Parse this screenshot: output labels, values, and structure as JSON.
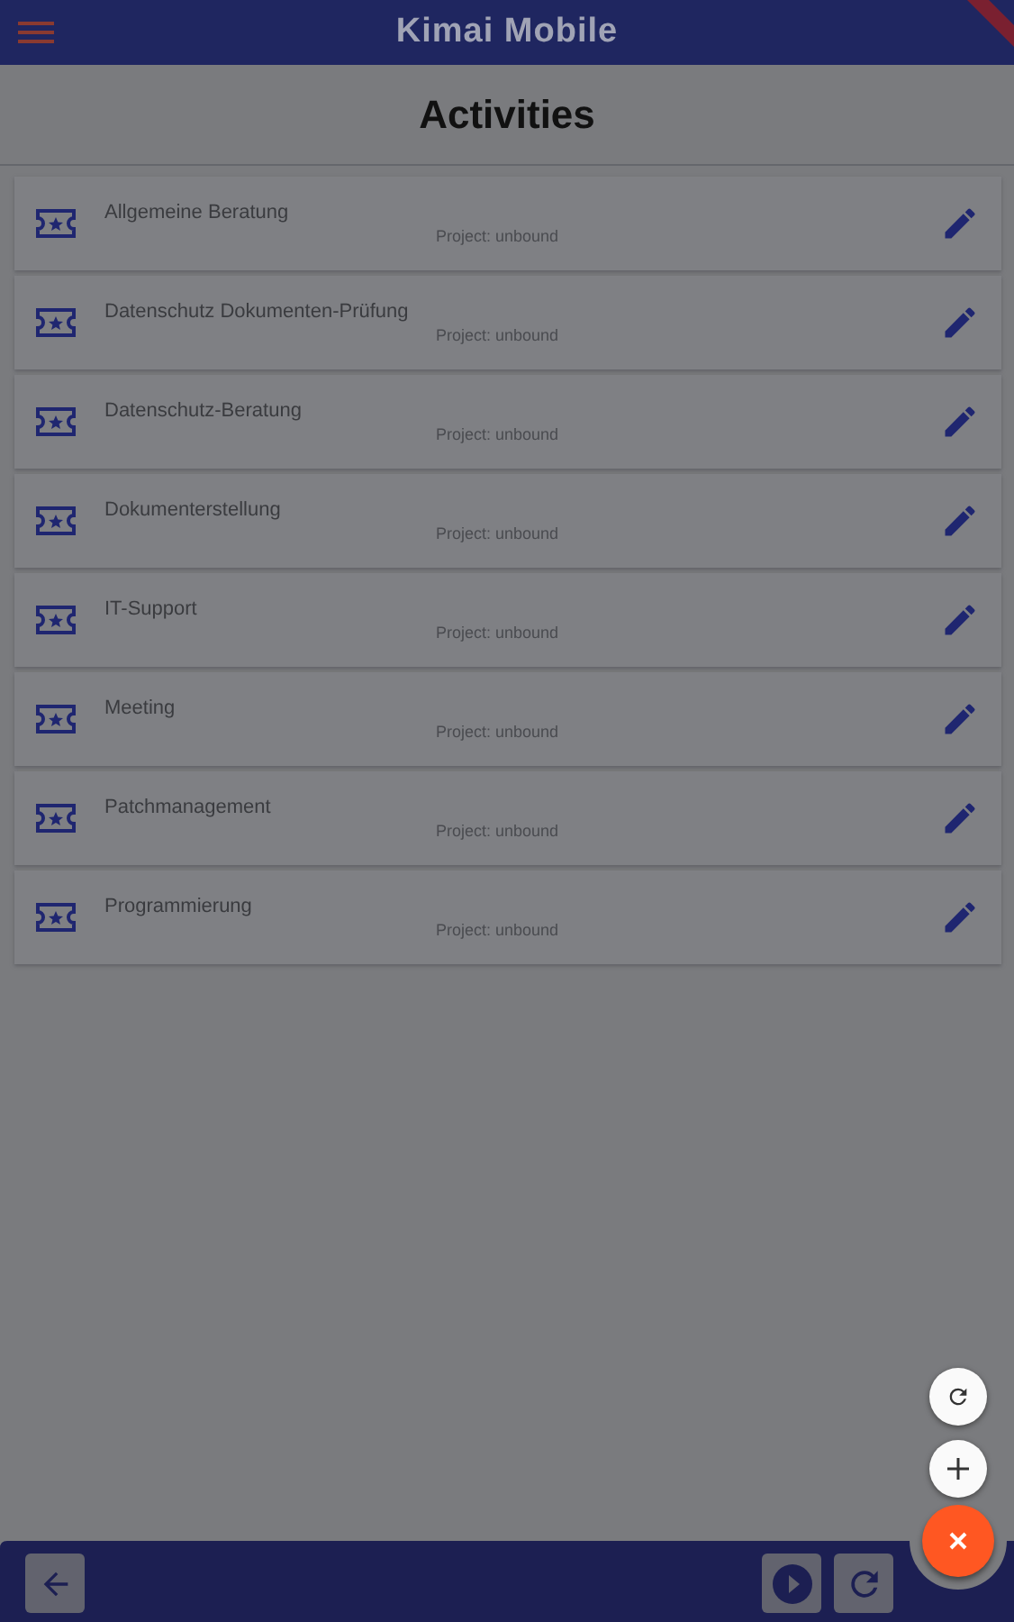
{
  "app_bar": {
    "title": "Kimai Mobile"
  },
  "page_title": "Activities",
  "activities": [
    {
      "name": "Allgemeine Beratung",
      "project": "Project: unbound"
    },
    {
      "name": "Datenschutz Dokumenten-Prüfung",
      "project": "Project: unbound"
    },
    {
      "name": "Datenschutz-Beratung",
      "project": "Project: unbound"
    },
    {
      "name": "Dokumenterstellung",
      "project": "Project: unbound"
    },
    {
      "name": "IT-Support",
      "project": "Project: unbound"
    },
    {
      "name": "Meeting",
      "project": "Project: unbound"
    },
    {
      "name": "Patchmanagement",
      "project": "Project: unbound"
    },
    {
      "name": "Programmierung",
      "project": "Project: unbound"
    }
  ],
  "fab_menu": {
    "expanded": true
  }
}
